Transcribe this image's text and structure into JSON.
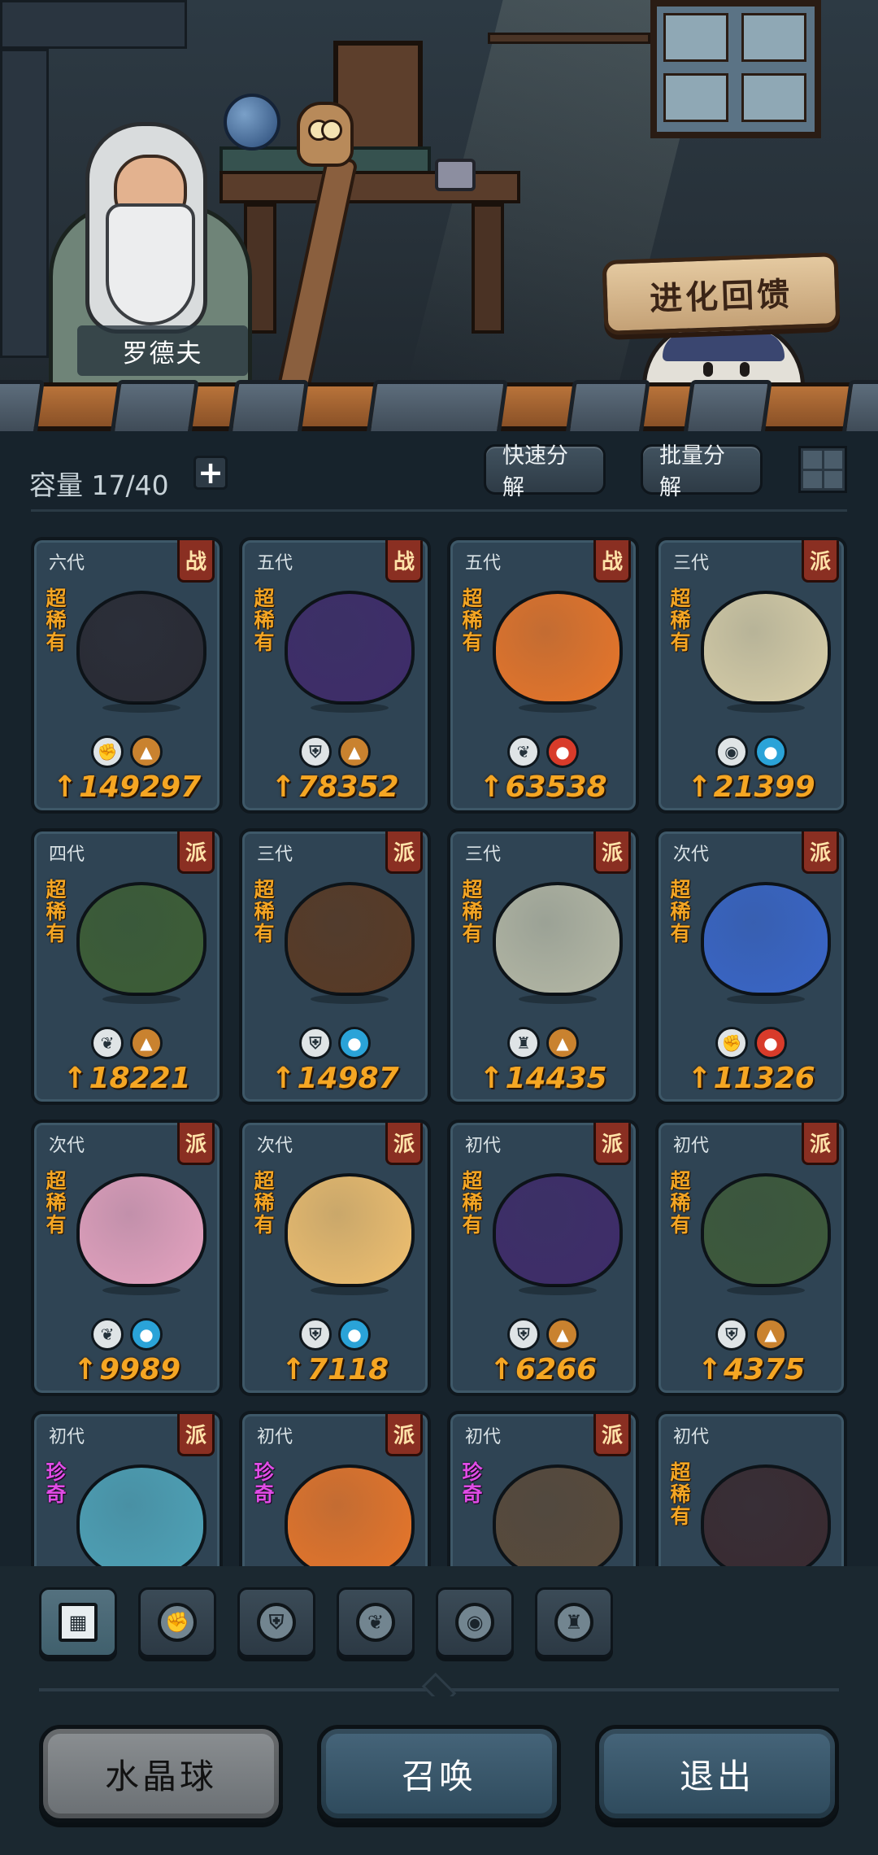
{
  "npc": {
    "name": "罗德夫"
  },
  "evolution_feedback": {
    "label": "进化回馈"
  },
  "inventory": {
    "capacity_label": "容量 17/40",
    "add_label": "+",
    "quick_decompose": "快速分解",
    "batch_decompose": "批量分解"
  },
  "colors": {
    "power": "#f5a623",
    "rarity_super": "#f3a524",
    "rarity_precious": "#e04ce6",
    "tag_bg": "#8a2f22"
  },
  "cards": [
    {
      "gen": "六代",
      "tag": "战",
      "rarity": "超稀有",
      "rarity_type": "super",
      "power": "149297",
      "creature_color": "#2a2a33",
      "badges": [
        {
          "icon": "fist-icon",
          "glyph": "✊",
          "bg": "#dfe4e6"
        },
        {
          "icon": "earth-icon",
          "glyph": "▲",
          "bg": "#c9822f"
        }
      ]
    },
    {
      "gen": "五代",
      "tag": "战",
      "rarity": "超稀有",
      "rarity_type": "super",
      "power": "78352",
      "creature_color": "#3f2c6a",
      "badges": [
        {
          "icon": "shield-icon",
          "glyph": "⛨",
          "bg": "#dfe4e6"
        },
        {
          "icon": "earth-icon",
          "glyph": "▲",
          "bg": "#c9822f"
        }
      ]
    },
    {
      "gen": "五代",
      "tag": "战",
      "rarity": "超稀有",
      "rarity_type": "super",
      "power": "63538",
      "creature_color": "#e8762a",
      "badges": [
        {
          "icon": "sprout-icon",
          "glyph": "❦",
          "bg": "#dfe4e6"
        },
        {
          "icon": "fire-icon",
          "glyph": "●",
          "bg": "#d83b2a"
        }
      ]
    },
    {
      "gen": "三代",
      "tag": "派",
      "rarity": "超稀有",
      "rarity_type": "super",
      "power": "21399",
      "creature_color": "#d9cfa9",
      "badges": [
        {
          "icon": "alien-icon",
          "glyph": "◉",
          "bg": "#dfe4e6"
        },
        {
          "icon": "water-icon",
          "glyph": "●",
          "bg": "#2aa3d8"
        }
      ]
    },
    {
      "gen": "四代",
      "tag": "派",
      "rarity": "超稀有",
      "rarity_type": "super",
      "power": "18221",
      "creature_color": "#3d5e35",
      "badges": [
        {
          "icon": "sprout-icon",
          "glyph": "❦",
          "bg": "#dfe4e6"
        },
        {
          "icon": "earth-icon",
          "glyph": "▲",
          "bg": "#c9822f"
        }
      ]
    },
    {
      "gen": "三代",
      "tag": "派",
      "rarity": "超稀有",
      "rarity_type": "super",
      "power": "14987",
      "creature_color": "#5a3a24",
      "badges": [
        {
          "icon": "shield-icon",
          "glyph": "⛨",
          "bg": "#dfe4e6"
        },
        {
          "icon": "water-icon",
          "glyph": "●",
          "bg": "#2aa3d8"
        }
      ]
    },
    {
      "gen": "三代",
      "tag": "派",
      "rarity": "超稀有",
      "rarity_type": "super",
      "power": "14435",
      "creature_color": "#b6b9a6",
      "badges": [
        {
          "icon": "tower-icon",
          "glyph": "♜",
          "bg": "#dfe4e6"
        },
        {
          "icon": "earth-icon",
          "glyph": "▲",
          "bg": "#c9822f"
        }
      ]
    },
    {
      "gen": "次代",
      "tag": "派",
      "rarity": "超稀有",
      "rarity_type": "super",
      "power": "11326",
      "creature_color": "#3a66c8",
      "badges": [
        {
          "icon": "fist-icon",
          "glyph": "✊",
          "bg": "#dfe4e6"
        },
        {
          "icon": "fire-icon",
          "glyph": "●",
          "bg": "#d83b2a"
        }
      ]
    },
    {
      "gen": "次代",
      "tag": "派",
      "rarity": "超稀有",
      "rarity_type": "super",
      "power": "9989",
      "creature_color": "#e6a3c0",
      "badges": [
        {
          "icon": "sprout-icon",
          "glyph": "❦",
          "bg": "#dfe4e6"
        },
        {
          "icon": "water-icon",
          "glyph": "●",
          "bg": "#2aa3d8"
        }
      ]
    },
    {
      "gen": "次代",
      "tag": "派",
      "rarity": "超稀有",
      "rarity_type": "super",
      "power": "7118",
      "creature_color": "#f0c070",
      "badges": [
        {
          "icon": "shield-icon",
          "glyph": "⛨",
          "bg": "#dfe4e6"
        },
        {
          "icon": "water-icon",
          "glyph": "●",
          "bg": "#2aa3d8"
        }
      ]
    },
    {
      "gen": "初代",
      "tag": "派",
      "rarity": "超稀有",
      "rarity_type": "super",
      "power": "6266",
      "creature_color": "#3f2c6a",
      "badges": [
        {
          "icon": "shield-icon",
          "glyph": "⛨",
          "bg": "#dfe4e6"
        },
        {
          "icon": "earth-icon",
          "glyph": "▲",
          "bg": "#c9822f"
        }
      ]
    },
    {
      "gen": "初代",
      "tag": "派",
      "rarity": "超稀有",
      "rarity_type": "super",
      "power": "4375",
      "creature_color": "#3e5a3a",
      "badges": [
        {
          "icon": "shield-icon",
          "glyph": "⛨",
          "bg": "#dfe4e6"
        },
        {
          "icon": "earth-icon",
          "glyph": "▲",
          "bg": "#c9822f"
        }
      ]
    },
    {
      "gen": "初代",
      "tag": "派",
      "rarity": "珍奇",
      "rarity_type": "precious",
      "power": "",
      "creature_color": "#4fa3b8",
      "badges": []
    },
    {
      "gen": "初代",
      "tag": "派",
      "rarity": "珍奇",
      "rarity_type": "precious",
      "power": "",
      "creature_color": "#e8762a",
      "badges": []
    },
    {
      "gen": "初代",
      "tag": "派",
      "rarity": "珍奇",
      "rarity_type": "precious",
      "power": "",
      "creature_color": "#5a4a3a",
      "badges": []
    },
    {
      "gen": "初代",
      "tag": "",
      "rarity": "超稀有",
      "rarity_type": "super",
      "power": "",
      "creature_color": "#3a2a30",
      "badges": []
    }
  ],
  "filter_tabs": [
    {
      "name": "all",
      "icon": "blocks-icon",
      "glyph": "▦",
      "active": true
    },
    {
      "name": "fist",
      "icon": "fist-icon",
      "glyph": "✊",
      "active": false
    },
    {
      "name": "shield",
      "icon": "shield-icon",
      "glyph": "⛨",
      "active": false
    },
    {
      "name": "sprout",
      "icon": "sprout-icon",
      "glyph": "❦",
      "active": false
    },
    {
      "name": "alien",
      "icon": "alien-icon",
      "glyph": "◉",
      "active": false
    },
    {
      "name": "tower",
      "icon": "tower-icon",
      "glyph": "♜",
      "active": false
    }
  ],
  "bottom_buttons": {
    "crystal_ball": "水晶球",
    "summon": "召唤",
    "exit": "退出"
  }
}
